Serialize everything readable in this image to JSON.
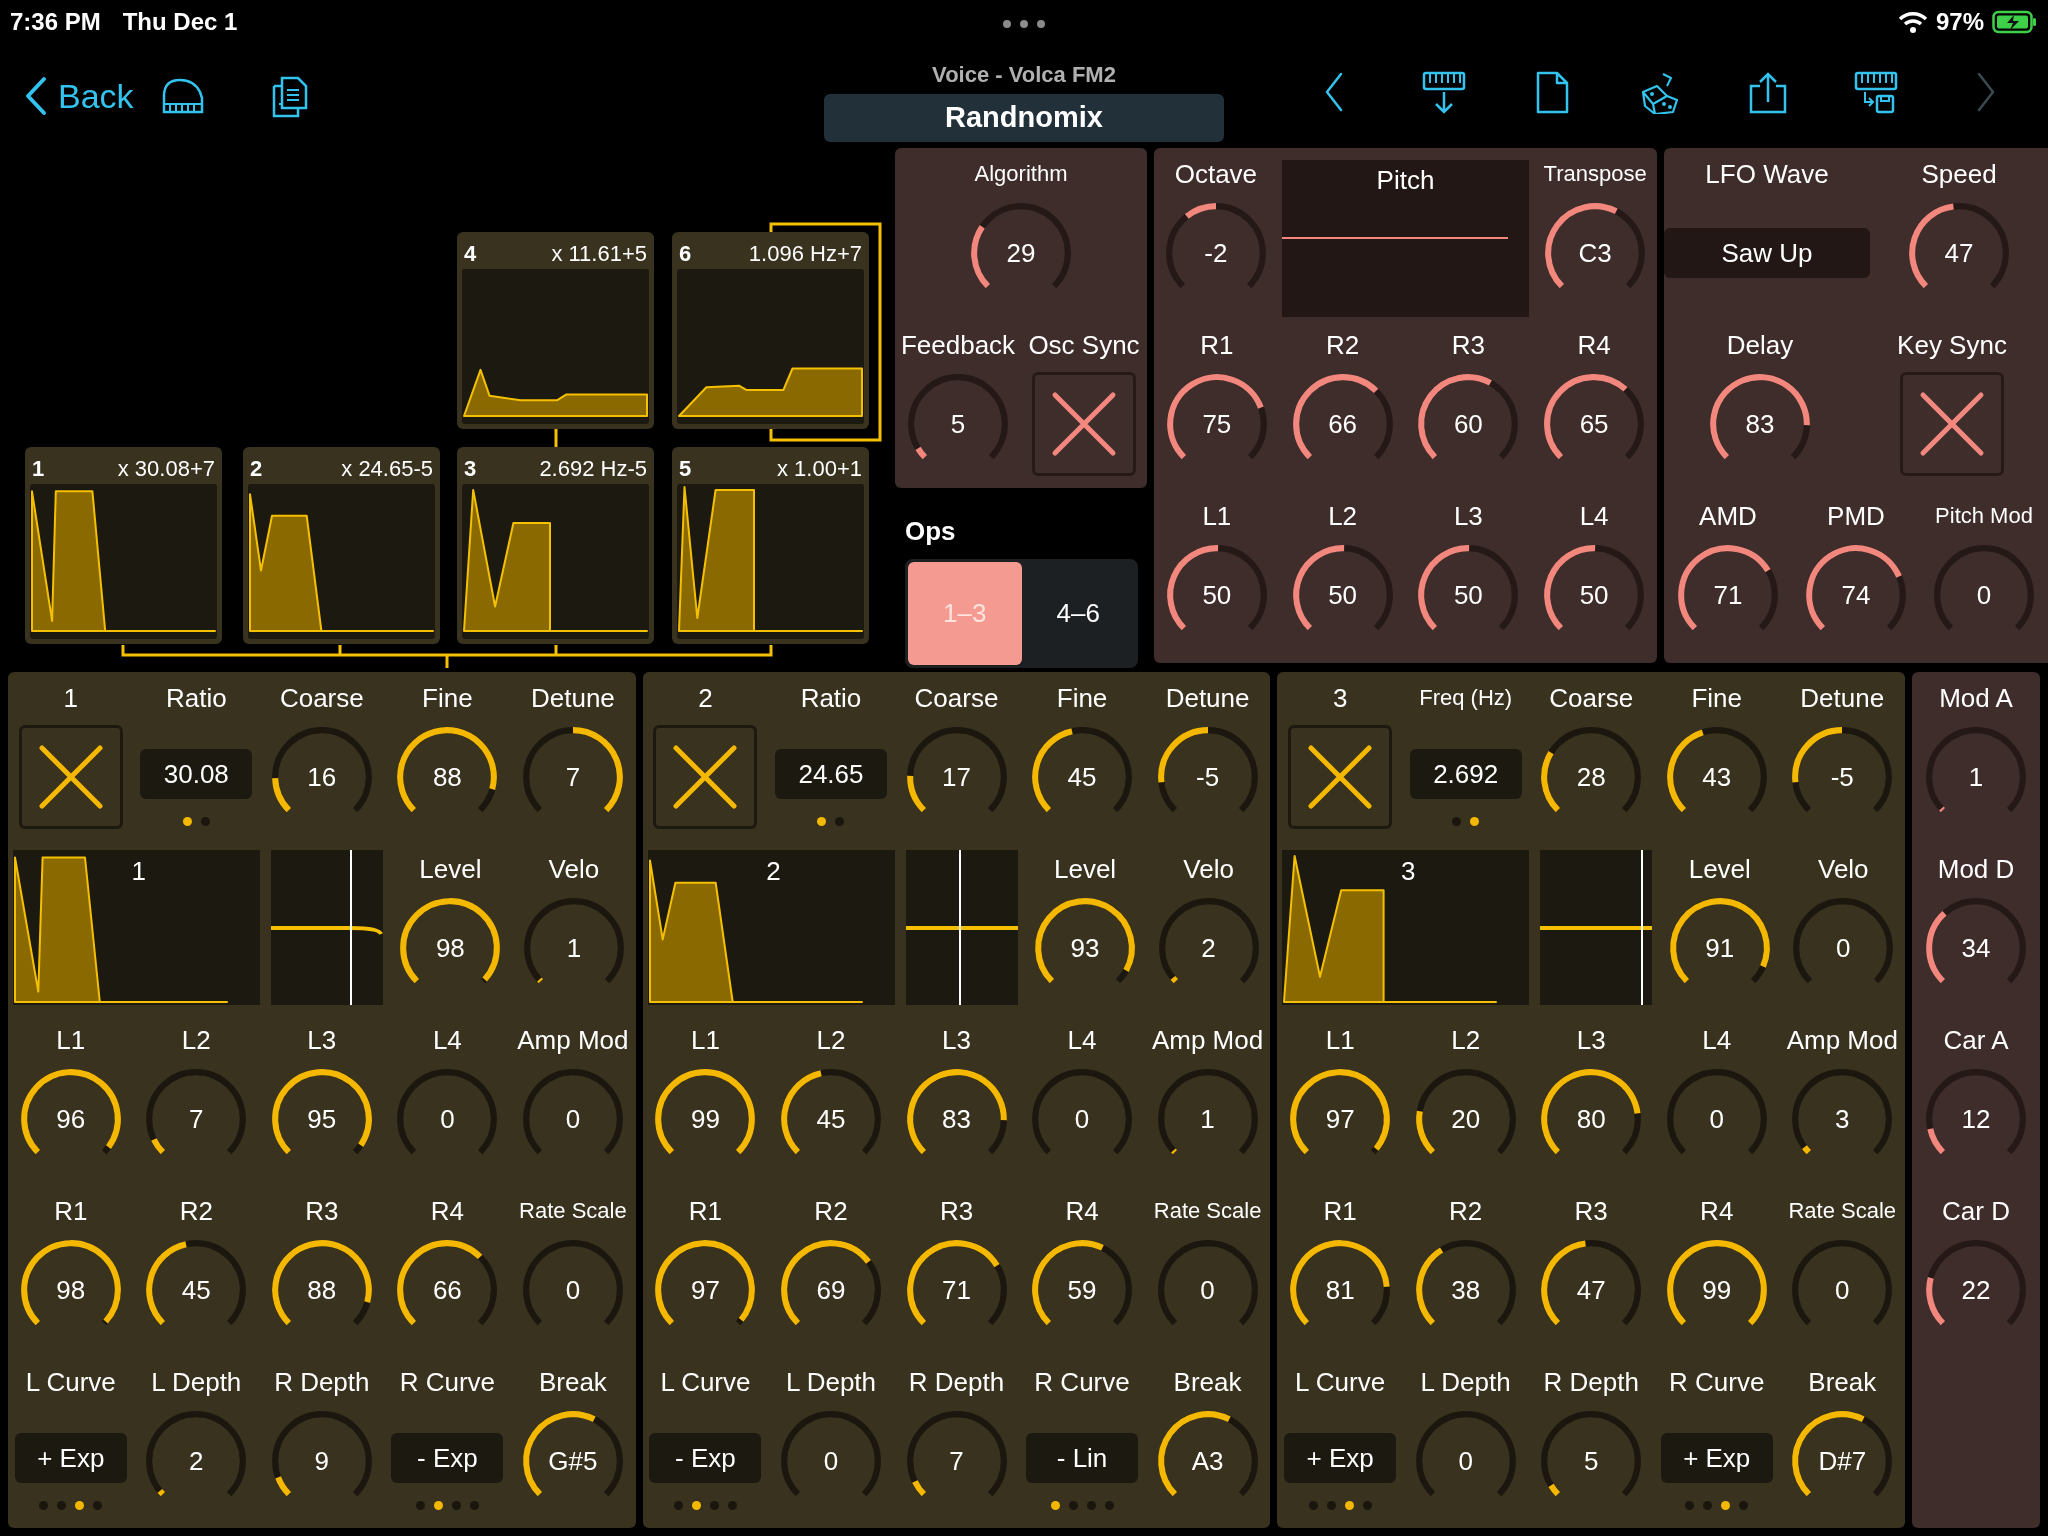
{
  "status_bar": {
    "time": "7:36 PM",
    "date": "Thu Dec 1",
    "battery": "97%"
  },
  "nav": {
    "back": "Back",
    "subtitle": "Voice - Volca FM2",
    "name": "Randnomix"
  },
  "algorithm_diagram": {
    "operators": [
      {
        "number": "4",
        "label": "x 11.61+5"
      },
      {
        "number": "6",
        "label": "1.096 Hz+7"
      },
      {
        "number": "1",
        "label": "x 30.08+7"
      },
      {
        "number": "2",
        "label": "x 24.65-5"
      },
      {
        "number": "3",
        "label": "2.692 Hz-5"
      },
      {
        "number": "5",
        "label": "x 1.00+1"
      }
    ]
  },
  "global_panels": [
    {
      "rows": [
        [
          {
            "kind": "knob",
            "label": "Algorithm",
            "value": "29"
          }
        ],
        [
          {
            "kind": "knob",
            "label": "Feedback",
            "value": "5"
          },
          {
            "kind": "toggle",
            "label": "Osc Sync"
          }
        ]
      ]
    },
    {
      "rows": [
        [
          {
            "kind": "center-knob",
            "label": "Octave",
            "value": "-2"
          },
          {
            "kind": "pitch-env",
            "label": "Pitch"
          },
          "",
          {
            "kind": "knob",
            "label": "Transpose",
            "value": "C3"
          }
        ],
        [
          {
            "kind": "knob",
            "label": "R1",
            "value": "75"
          },
          {
            "kind": "knob",
            "label": "R2",
            "value": "66"
          },
          {
            "kind": "knob",
            "label": "R3",
            "value": "60"
          },
          {
            "kind": "knob",
            "label": "R4",
            "value": "65"
          }
        ],
        [
          {
            "kind": "knob",
            "label": "L1",
            "value": "50"
          },
          {
            "kind": "knob",
            "label": "L2",
            "value": "50"
          },
          {
            "kind": "knob",
            "label": "L3",
            "value": "50"
          },
          {
            "kind": "knob",
            "label": "L4",
            "value": "50"
          }
        ]
      ]
    },
    {
      "rows": [
        [
          {
            "kind": "field",
            "label": "LFO Wave",
            "value": "Saw Up"
          },
          {
            "kind": "knob",
            "label": "Speed",
            "value": "47"
          }
        ],
        [
          {
            "kind": "knob",
            "label": "Delay",
            "value": "83"
          },
          {
            "kind": "toggle",
            "label": "Key Sync"
          }
        ],
        [
          {
            "kind": "knob",
            "label": "AMD",
            "value": "71"
          },
          {
            "kind": "knob",
            "label": "PMD",
            "value": "74"
          },
          {
            "kind": "knob",
            "label": "Pitch Mod",
            "value": "0"
          }
        ]
      ]
    }
  ],
  "ops_switch": {
    "label": "Ops",
    "options": [
      {
        "label": "1–3",
        "selected": true
      },
      {
        "label": "4–6",
        "selected": false
      }
    ]
  },
  "operators": [
    {
      "rows": [
        [
          {
            "kind": "toggle",
            "label": "1"
          },
          {
            "kind": "field",
            "label": "Ratio",
            "value": "30.08",
            "dots": [
              {
                "selected": true
              },
              {
                "selected": false
              }
            ]
          },
          {
            "kind": "knob",
            "label": "Coarse",
            "value": "16"
          },
          {
            "kind": "knob",
            "label": "Fine",
            "value": "88"
          },
          {
            "kind": "center-knob",
            "label": "Detune",
            "value": "7"
          }
        ],
        [
          {
            "kind": "envelope",
            "label": "1"
          },
          "",
          {
            "kind": "scaling"
          },
          {
            "kind": "knob",
            "label": "Level",
            "value": "98"
          },
          {
            "kind": "knob",
            "label": "Velo",
            "value": "1"
          }
        ],
        [
          {
            "kind": "knob",
            "label": "L1",
            "value": "96"
          },
          {
            "kind": "knob",
            "label": "L2",
            "value": "7"
          },
          {
            "kind": "knob",
            "label": "L3",
            "value": "95"
          },
          {
            "kind": "knob",
            "label": "L4",
            "value": "0"
          },
          {
            "kind": "knob",
            "label": "Amp Mod",
            "value": "0"
          }
        ],
        [
          {
            "kind": "knob",
            "label": "R1",
            "value": "98"
          },
          {
            "kind": "knob",
            "label": "R2",
            "value": "45"
          },
          {
            "kind": "knob",
            "label": "R3",
            "value": "88"
          },
          {
            "kind": "knob",
            "label": "R4",
            "value": "66"
          },
          {
            "kind": "knob",
            "label": "Rate Scale",
            "value": "0"
          }
        ],
        [
          {
            "kind": "field",
            "label": "L Curve",
            "value": "+ Exp",
            "dots": [
              {
                "selected": false
              },
              {
                "selected": false
              },
              {
                "selected": true
              },
              {
                "selected": false
              }
            ]
          },
          {
            "kind": "knob",
            "label": "L Depth",
            "value": "2"
          },
          {
            "kind": "knob",
            "label": "R Depth",
            "value": "9"
          },
          {
            "kind": "field",
            "label": "R Curve",
            "value": "- Exp",
            "dots": [
              {
                "selected": false
              },
              {
                "selected": true
              },
              {
                "selected": false
              },
              {
                "selected": false
              }
            ]
          },
          {
            "kind": "knob",
            "label": "Break",
            "value": "G#5"
          }
        ]
      ]
    },
    {
      "rows": [
        [
          {
            "kind": "toggle",
            "label": "2"
          },
          {
            "kind": "field",
            "label": "Ratio",
            "value": "24.65",
            "dots": [
              {
                "selected": true
              },
              {
                "selected": false
              }
            ]
          },
          {
            "kind": "knob",
            "label": "Coarse",
            "value": "17"
          },
          {
            "kind": "knob",
            "label": "Fine",
            "value": "45"
          },
          {
            "kind": "center-knob",
            "label": "Detune",
            "value": "-5"
          }
        ],
        [
          {
            "kind": "envelope",
            "label": "2"
          },
          "",
          {
            "kind": "scaling"
          },
          {
            "kind": "knob",
            "label": "Level",
            "value": "93"
          },
          {
            "kind": "knob",
            "label": "Velo",
            "value": "2"
          }
        ],
        [
          {
            "kind": "knob",
            "label": "L1",
            "value": "99"
          },
          {
            "kind": "knob",
            "label": "L2",
            "value": "45"
          },
          {
            "kind": "knob",
            "label": "L3",
            "value": "83"
          },
          {
            "kind": "knob",
            "label": "L4",
            "value": "0"
          },
          {
            "kind": "knob",
            "label": "Amp Mod",
            "value": "1"
          }
        ],
        [
          {
            "kind": "knob",
            "label": "R1",
            "value": "97"
          },
          {
            "kind": "knob",
            "label": "R2",
            "value": "69"
          },
          {
            "kind": "knob",
            "label": "R3",
            "value": "71"
          },
          {
            "kind": "knob",
            "label": "R4",
            "value": "59"
          },
          {
            "kind": "knob",
            "label": "Rate Scale",
            "value": "0"
          }
        ],
        [
          {
            "kind": "field",
            "label": "L Curve",
            "value": "- Exp",
            "dots": [
              {
                "selected": false
              },
              {
                "selected": true
              },
              {
                "selected": false
              },
              {
                "selected": false
              }
            ]
          },
          {
            "kind": "knob",
            "label": "L Depth",
            "value": "0"
          },
          {
            "kind": "knob",
            "label": "R Depth",
            "value": "7"
          },
          {
            "kind": "field",
            "label": "R Curve",
            "value": "- Lin",
            "dots": [
              {
                "selected": true
              },
              {
                "selected": false
              },
              {
                "selected": false
              },
              {
                "selected": false
              }
            ]
          },
          {
            "kind": "knob",
            "label": "Break",
            "value": "A3"
          }
        ]
      ]
    },
    {
      "rows": [
        [
          {
            "kind": "toggle",
            "label": "3"
          },
          {
            "kind": "field",
            "label": "Freq (Hz)",
            "value": "2.692",
            "dots": [
              {
                "selected": false
              },
              {
                "selected": true
              }
            ]
          },
          {
            "kind": "knob",
            "label": "Coarse",
            "value": "28"
          },
          {
            "kind": "knob",
            "label": "Fine",
            "value": "43"
          },
          {
            "kind": "center-knob",
            "label": "Detune",
            "value": "-5"
          }
        ],
        [
          {
            "kind": "envelope",
            "label": "3"
          },
          "",
          {
            "kind": "scaling"
          },
          {
            "kind": "knob",
            "label": "Level",
            "value": "91"
          },
          {
            "kind": "knob",
            "label": "Velo",
            "value": "0"
          }
        ],
        [
          {
            "kind": "knob",
            "label": "L1",
            "value": "97"
          },
          {
            "kind": "knob",
            "label": "L2",
            "value": "20"
          },
          {
            "kind": "knob",
            "label": "L3",
            "value": "80"
          },
          {
            "kind": "knob",
            "label": "L4",
            "value": "0"
          },
          {
            "kind": "knob",
            "label": "Amp Mod",
            "value": "3"
          }
        ],
        [
          {
            "kind": "knob",
            "label": "R1",
            "value": "81"
          },
          {
            "kind": "knob",
            "label": "R2",
            "value": "38"
          },
          {
            "kind": "knob",
            "label": "R3",
            "value": "47"
          },
          {
            "kind": "knob",
            "label": "R4",
            "value": "99"
          },
          {
            "kind": "knob",
            "label": "Rate Scale",
            "value": "0"
          }
        ],
        [
          {
            "kind": "field",
            "label": "L Curve",
            "value": "+ Exp",
            "dots": [
              {
                "selected": false
              },
              {
                "selected": false
              },
              {
                "selected": true
              },
              {
                "selected": false
              }
            ]
          },
          {
            "kind": "knob",
            "label": "L Depth",
            "value": "0"
          },
          {
            "kind": "knob",
            "label": "R Depth",
            "value": "5"
          },
          {
            "kind": "field",
            "label": "R Curve",
            "value": "+ Exp",
            "dots": [
              {
                "selected": false
              },
              {
                "selected": false
              },
              {
                "selected": true
              },
              {
                "selected": false
              }
            ]
          },
          {
            "kind": "knob",
            "label": "Break",
            "value": "D#7"
          }
        ]
      ]
    }
  ],
  "modulation": {
    "rows": [
      [
        {
          "kind": "knob",
          "label": "Mod A",
          "value": "1"
        }
      ],
      [
        {
          "kind": "knob",
          "label": "Mod D",
          "value": "34"
        }
      ],
      [
        {
          "kind": "knob",
          "label": "Car A",
          "value": "12"
        }
      ],
      [
        {
          "kind": "knob",
          "label": "Car D",
          "value": "22"
        }
      ]
    ]
  }
}
